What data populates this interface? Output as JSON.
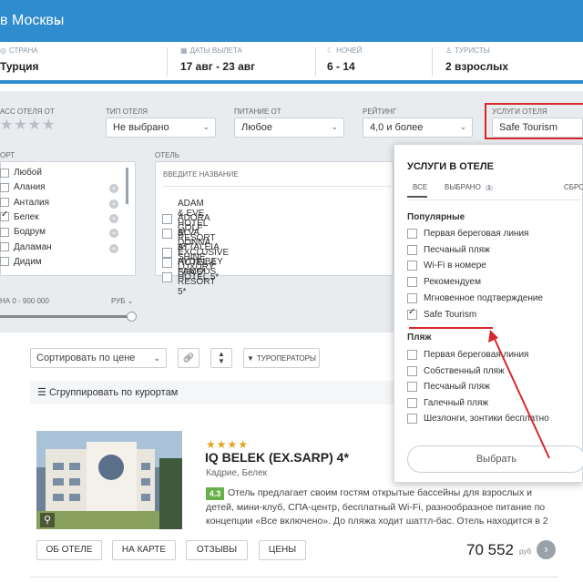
{
  "header": {
    "city": "в Москвы"
  },
  "criteria": [
    {
      "label": "СТРАНА",
      "value": "Турция",
      "icon": "globe-icon"
    },
    {
      "label": "ДАТЫ ВЫЛЕТА",
      "value": "17 авг - 23 авг",
      "icon": "calendar-icon"
    },
    {
      "label": "НОЧЕЙ",
      "value": "6 - 14",
      "icon": "moon-icon"
    },
    {
      "label": "ТУРИСТЫ",
      "value": "2 взрослых",
      "icon": "person-icon"
    }
  ],
  "filters": {
    "class_label": "АСС ОТЕЛЯ ОТ",
    "type_label": "ТИП ОТЕЛЯ",
    "type_value": "Не выбрано",
    "meal_label": "ПИТАНИЕ ОТ",
    "meal_value": "Любое",
    "rating_label": "РЕЙТИНГ",
    "rating_value": "4,0 и более",
    "services_label": "УСЛУГИ ОТЕЛЯ",
    "services_value": "Safe Tourism",
    "resort_label": "ОРТ",
    "hotel_label": "ОТЕЛЬ",
    "hotel_placeholder": "ВВЕДИТЕ НАЗВАНИЕ",
    "resorts": [
      {
        "name": "Любой",
        "checked": false
      },
      {
        "name": "Алания",
        "checked": false
      },
      {
        "name": "Анталия",
        "checked": false
      },
      {
        "name": "Белек",
        "checked": true
      },
      {
        "name": "Бодрум",
        "checked": false
      },
      {
        "name": "Даламан",
        "checked": false
      },
      {
        "name": "Дидим",
        "checked": false
      }
    ],
    "hotels": [
      "ADAM & EVE HOTEL 5*",
      "ADORA GOLF RESORT 5*",
      "ALVA DONNA EXCLUSIVE HOTEL & SPA 5*",
      "ATTALEIA SHINE LUXURY HOTEL 5*",
      "AYDINBEY FAMOUS RESORT 5*"
    ],
    "price_range": "НА  0 - 900 000",
    "currency": "РУБ"
  },
  "services_popup": {
    "title": "УСЛУГИ В ОТЕЛЕ",
    "tabs": [
      "ВСЕ",
      "ВЫБРАНО",
      "СБРО"
    ],
    "selected_count": "1",
    "popular_title": "Популярные",
    "popular": [
      {
        "label": "Первая береговая линия",
        "checked": false
      },
      {
        "label": "Песчаный пляж",
        "checked": false
      },
      {
        "label": "Wi-Fi в номере",
        "checked": false
      },
      {
        "label": "Рекомендуем",
        "checked": false
      },
      {
        "label": "Мгновенное подтверждение",
        "checked": false
      },
      {
        "label": "Safe Tourism",
        "checked": true
      }
    ],
    "beach_title": "Пляж",
    "beach": [
      {
        "label": "Первая береговая линия",
        "checked": false
      },
      {
        "label": "Собственный пляж",
        "checked": false
      },
      {
        "label": "Песчаный пляж",
        "checked": false
      },
      {
        "label": "Галечный пляж",
        "checked": false
      },
      {
        "label": "Шезлонги, зонтики бесплатно",
        "checked": false
      }
    ],
    "choose_label": "Выбрать"
  },
  "sort": {
    "sort_label": "Сортировать по цене",
    "operators_label": "ТУРОПЕРАТОРЫ",
    "group_label": "Сгруппировать по курортам"
  },
  "result": {
    "stars": "★★★★",
    "name": "IQ BELEK (EX.SARP) 4*",
    "location": "Кадрие, Белек",
    "rating": "4.3",
    "description": "Отель предлагает своим гостям открытые бассейны для взрослых и детей, мини-клуб, СПА-центр, бесплатный Wi-Fi, разнообразное питание по концепции «Все включено». До пляжа ходит шаттл-бас. Отель находится в 2",
    "buttons": [
      "ОБ ОТЕЛЕ",
      "НА КАРТЕ",
      "ОТЗЫВЫ",
      "ЦЕНЫ"
    ],
    "price": "70 552",
    "currency": "руб"
  },
  "colors": {
    "brand": "#2f8ccf",
    "highlight": "#d9272e",
    "rating": "#67b04b"
  }
}
